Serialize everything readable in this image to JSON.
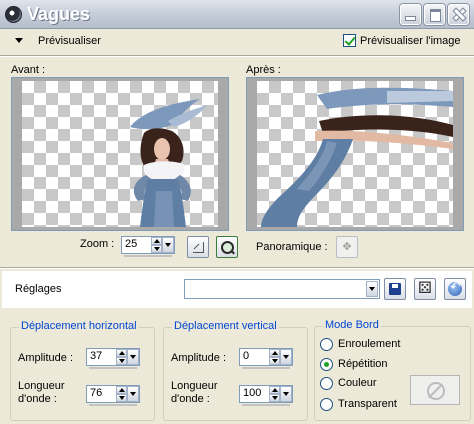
{
  "window": {
    "title": "Vagues"
  },
  "preview_section": {
    "label": "Prévisualiser",
    "show_preview_label": "Prévisualiser l'image",
    "show_preview_checked": true
  },
  "previews": {
    "before_label": "Avant :",
    "after_label": "Après :"
  },
  "zoom": {
    "label": "Zoom :",
    "value": "25"
  },
  "pan": {
    "label": "Panoramique :",
    "icon": "move-icon"
  },
  "settings": {
    "label": "Réglages",
    "preset_value": ""
  },
  "horizontal_offset": {
    "title": "Déplacement horizontal",
    "amplitude_label": "Amplitude :",
    "amplitude_value": "37",
    "wavelength_label_line1": "Longueur",
    "wavelength_label_line2": "d'onde :",
    "wavelength_value": "76"
  },
  "vertical_offset": {
    "title": "Déplacement vertical",
    "amplitude_label": "Amplitude :",
    "amplitude_value": "0",
    "wavelength_label_line1": "Longueur",
    "wavelength_label_line2": "d'onde :",
    "wavelength_value": "100"
  },
  "edge_mode": {
    "title": "Mode Bord",
    "options": [
      "Enroulement",
      "Répétition",
      "Couleur",
      "Transparent"
    ],
    "selected": "Répétition"
  },
  "colors": {
    "accent_blue": "#0046d5",
    "check_green": "#21a121"
  }
}
